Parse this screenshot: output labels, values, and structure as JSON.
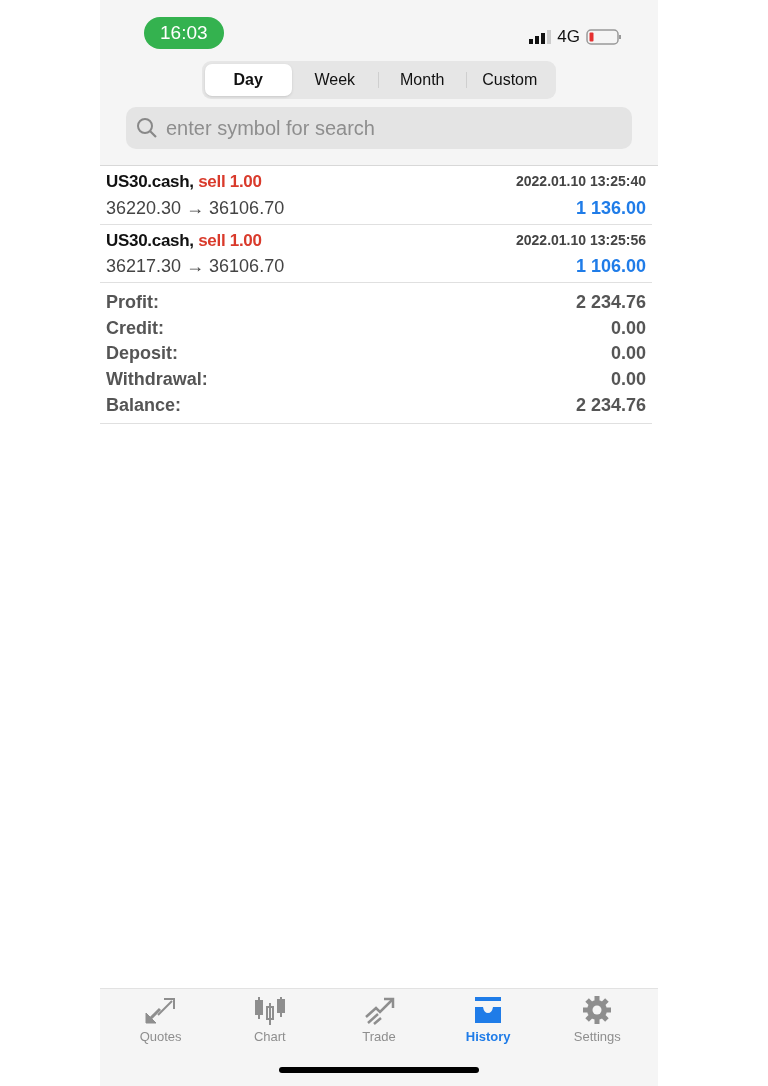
{
  "status_bar": {
    "time": "16:03",
    "network": "4G"
  },
  "period_tabs": [
    {
      "label": "Day",
      "selected": true
    },
    {
      "label": "Week",
      "selected": false
    },
    {
      "label": "Month",
      "selected": false
    },
    {
      "label": "Custom",
      "selected": false
    }
  ],
  "search": {
    "placeholder": "enter symbol for search"
  },
  "deals": [
    {
      "symbol": "US30.cash,",
      "side": "sell 1.00",
      "kind": "sell",
      "time": "2022.01.10 13:25:40",
      "prices": "36220.30 → 36106.70",
      "profit": "1 136.00"
    },
    {
      "symbol": "US30.cash,",
      "side": "sell 1.00",
      "kind": "sell",
      "time": "2022.01.10 13:25:56",
      "prices": "36217.30 → 36106.70",
      "profit": "1 106.00"
    }
  ],
  "summary": [
    {
      "label": "Profit:",
      "value": "2 234.76"
    },
    {
      "label": "Credit:",
      "value": "0.00"
    },
    {
      "label": "Deposit:",
      "value": "0.00"
    },
    {
      "label": "Withdrawal:",
      "value": "0.00"
    },
    {
      "label": "Balance:",
      "value": "2 234.76"
    }
  ],
  "tab_bar": [
    {
      "label": "Quotes",
      "kind": "quotes",
      "selected": false
    },
    {
      "label": "Chart",
      "kind": "chart",
      "selected": false
    },
    {
      "label": "Trade",
      "kind": "trade",
      "selected": false
    },
    {
      "label": "History",
      "kind": "history",
      "selected": true
    },
    {
      "label": "Settings",
      "kind": "settings",
      "selected": false
    }
  ]
}
